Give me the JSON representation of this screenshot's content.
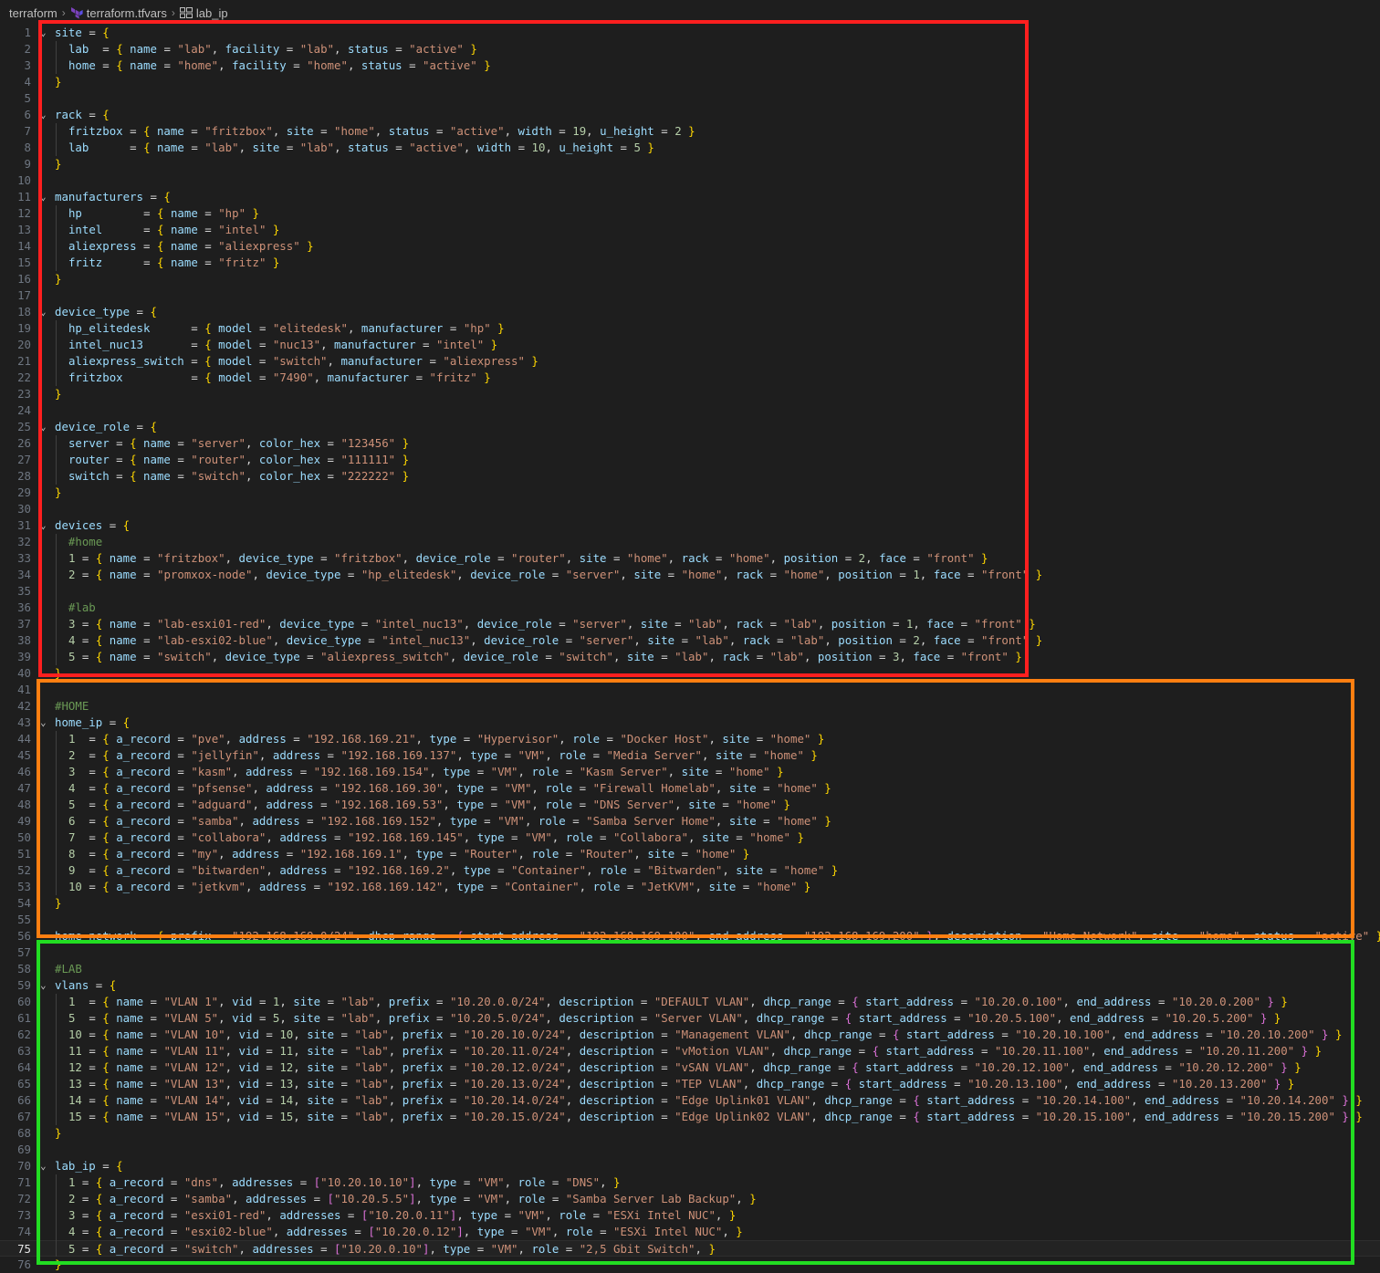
{
  "breadcrumb": {
    "items": [
      {
        "label": "terraform",
        "icon": "folder"
      },
      {
        "label": "terraform.tfvars",
        "icon": "terraform-icon"
      },
      {
        "label": "lab_ip",
        "icon": "symbol-object-icon"
      }
    ]
  },
  "editor": {
    "language": "terraform",
    "current_line": 75,
    "colors": {
      "keyword": "#9cdcfe",
      "string": "#ce9178",
      "number": "#b5cea8",
      "comment": "#6a9955",
      "bracket_level_1": "#ffd700",
      "bracket_level_2": "#da70d6",
      "bracket_level_3": "#179fff"
    },
    "lines": [
      "site = {",
      "  lab  = { name = \"lab\", facility = \"lab\", status = \"active\" }",
      "  home = { name = \"home\", facility = \"home\", status = \"active\" }",
      "}",
      "",
      "rack = {",
      "  fritzbox = { name = \"fritzbox\", site = \"home\", status = \"active\", width = 19, u_height = 2 }",
      "  lab      = { name = \"lab\", site = \"lab\", status = \"active\", width = 10, u_height = 5 }",
      "}",
      "",
      "manufacturers = {",
      "  hp         = { name = \"hp\" }",
      "  intel      = { name = \"intel\" }",
      "  aliexpress = { name = \"aliexpress\" }",
      "  fritz      = { name = \"fritz\" }",
      "}",
      "",
      "device_type = {",
      "  hp_elitedesk      = { model = \"elitedesk\", manufacturer = \"hp\" }",
      "  intel_nuc13       = { model = \"nuc13\", manufacturer = \"intel\" }",
      "  aliexpress_switch = { model = \"switch\", manufacturer = \"aliexpress\" }",
      "  fritzbox          = { model = \"7490\", manufacturer = \"fritz\" }",
      "}",
      "",
      "device_role = {",
      "  server = { name = \"server\", color_hex = \"123456\" }",
      "  router = { name = \"router\", color_hex = \"111111\" }",
      "  switch = { name = \"switch\", color_hex = \"222222\" }",
      "}",
      "",
      "devices = {",
      "  #home",
      "  1 = { name = \"fritzbox\", device_type = \"fritzbox\", device_role = \"router\", site = \"home\", rack = \"home\", position = 2, face = \"front\" }",
      "  2 = { name = \"promxox-node\", device_type = \"hp_elitedesk\", device_role = \"server\", site = \"home\", rack = \"home\", position = 1, face = \"front\" }",
      "",
      "  #lab",
      "  3 = { name = \"lab-esxi01-red\", device_type = \"intel_nuc13\", device_role = \"server\", site = \"lab\", rack = \"lab\", position = 1, face = \"front\" }",
      "  4 = { name = \"lab-esxi02-blue\", device_type = \"intel_nuc13\", device_role = \"server\", site = \"lab\", rack = \"lab\", position = 2, face = \"front\" }",
      "  5 = { name = \"switch\", device_type = \"aliexpress_switch\", device_role = \"switch\", site = \"lab\", rack = \"lab\", position = 3, face = \"front\" }",
      "}",
      "",
      "#HOME",
      "home_ip = {",
      "  1  = { a_record = \"pve\", address = \"192.168.169.21\", type = \"Hypervisor\", role = \"Docker Host\", site = \"home\" }",
      "  2  = { a_record = \"jellyfin\", address = \"192.168.169.137\", type = \"VM\", role = \"Media Server\", site = \"home\" }",
      "  3  = { a_record = \"kasm\", address = \"192.168.169.154\", type = \"VM\", role = \"Kasm Server\", site = \"home\" }",
      "  4  = { a_record = \"pfsense\", address = \"192.168.169.30\", type = \"VM\", role = \"Firewall Homelab\", site = \"home\" }",
      "  5  = { a_record = \"adguard\", address = \"192.168.169.53\", type = \"VM\", role = \"DNS Server\", site = \"home\" }",
      "  6  = { a_record = \"samba\", address = \"192.168.169.152\", type = \"VM\", role = \"Samba Server Home\", site = \"home\" }",
      "  7  = { a_record = \"collabora\", address = \"192.168.169.145\", type = \"VM\", role = \"Collabora\", site = \"home\" }",
      "  8  = { a_record = \"my\", address = \"192.168.169.1\", type = \"Router\", role = \"Router\", site = \"home\" }",
      "  9  = { a_record = \"bitwarden\", address = \"192.168.169.2\", type = \"Container\", role = \"Bitwarden\", site = \"home\" }",
      "  10 = { a_record = \"jetkvm\", address = \"192.168.169.142\", type = \"Container\", role = \"JetKVM\", site = \"home\" }",
      "}",
      "",
      "home_network = { prefix = \"192.168.169.0/24\", dhcp_range = { start_address = \"192.168.169.100\", end_address = \"192.168.169.200\" }, description = \"Home Network\", site = \"home\", status = \"active\" }",
      "",
      "#LAB",
      "vlans = {",
      "  1  = { name = \"VLAN 1\", vid = 1, site = \"lab\", prefix = \"10.20.0.0/24\", description = \"DEFAULT VLAN\", dhcp_range = { start_address = \"10.20.0.100\", end_address = \"10.20.0.200\" } }",
      "  5  = { name = \"VLAN 5\", vid = 5, site = \"lab\", prefix = \"10.20.5.0/24\", description = \"Server VLAN\", dhcp_range = { start_address = \"10.20.5.100\", end_address = \"10.20.5.200\" } }",
      "  10 = { name = \"VLAN 10\", vid = 10, site = \"lab\", prefix = \"10.20.10.0/24\", description = \"Management VLAN\", dhcp_range = { start_address = \"10.20.10.100\", end_address = \"10.20.10.200\" } }",
      "  11 = { name = \"VLAN 11\", vid = 11, site = \"lab\", prefix = \"10.20.11.0/24\", description = \"vMotion VLAN\", dhcp_range = { start_address = \"10.20.11.100\", end_address = \"10.20.11.200\" } }",
      "  12 = { name = \"VLAN 12\", vid = 12, site = \"lab\", prefix = \"10.20.12.0/24\", description = \"vSAN VLAN\", dhcp_range = { start_address = \"10.20.12.100\", end_address = \"10.20.12.200\" } }",
      "  13 = { name = \"VLAN 13\", vid = 13, site = \"lab\", prefix = \"10.20.13.0/24\", description = \"TEP VLAN\", dhcp_range = { start_address = \"10.20.13.100\", end_address = \"10.20.13.200\" } }",
      "  14 = { name = \"VLAN 14\", vid = 14, site = \"lab\", prefix = \"10.20.14.0/24\", description = \"Edge Uplink01 VLAN\", dhcp_range = { start_address = \"10.20.14.100\", end_address = \"10.20.14.200\" } }",
      "  15 = { name = \"VLAN 15\", vid = 15, site = \"lab\", prefix = \"10.20.15.0/24\", description = \"Edge Uplink02 VLAN\", dhcp_range = { start_address = \"10.20.15.100\", end_address = \"10.20.15.200\" } }",
      "}",
      "",
      "lab_ip = {",
      "  1 = { a_record = \"dns\", addresses = [\"10.20.10.10\"], type = \"VM\", role = \"DNS\", }",
      "  2 = { a_record = \"samba\", addresses = [\"10.20.5.5\"], type = \"VM\", role = \"Samba Server Lab Backup\", }",
      "  3 = { a_record = \"esxi01-red\", addresses = [\"10.20.0.11\"], type = \"VM\", role = \"ESXi Intel NUC\", }",
      "  4 = { a_record = \"esxi02-blue\", addresses = [\"10.20.0.12\"], type = \"VM\", role = \"ESXi Intel NUC\", }",
      "  5 = { a_record = \"switch\", addresses = [\"10.20.0.10\"], type = \"VM\", role = \"2,5 Gbit Switch\", }",
      "}"
    ]
  },
  "highlight_boxes": [
    {
      "name": "red-box",
      "color": "#ff1f1f",
      "from_line": 1,
      "to_line": 39
    },
    {
      "name": "orange-box",
      "color": "#ff7f11",
      "from_line": 41,
      "to_line": 55
    },
    {
      "name": "green-box",
      "color": "#22dd22",
      "from_line": 57,
      "to_line": 75
    }
  ]
}
